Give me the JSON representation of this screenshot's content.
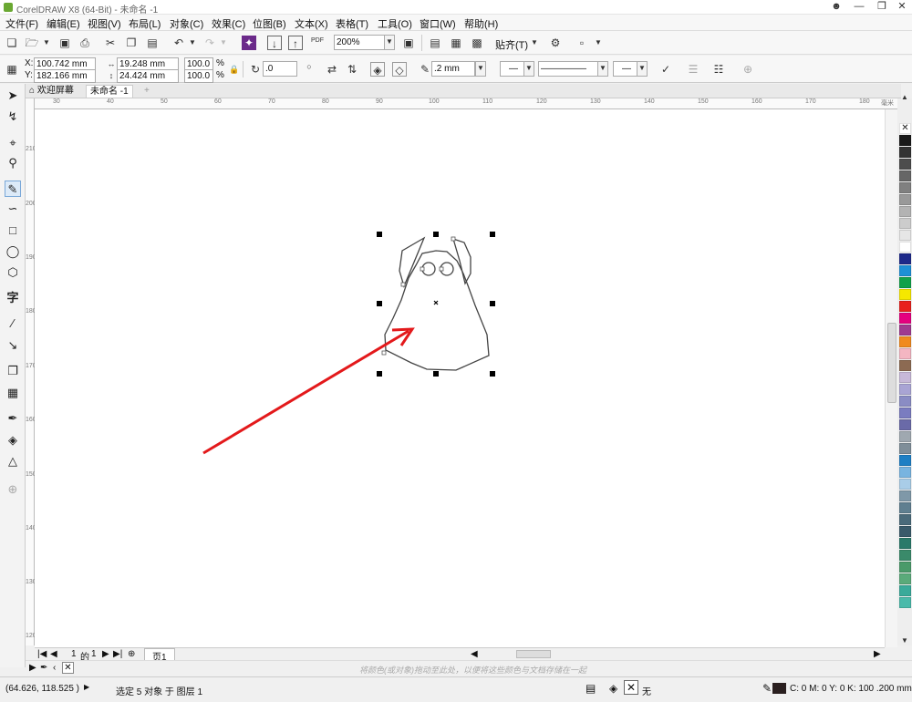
{
  "window": {
    "title": "CorelDRAW X8 (64-Bit) - 未命名 -1"
  },
  "menu": [
    "文件(F)",
    "编辑(E)",
    "视图(V)",
    "布局(L)",
    "对象(C)",
    "效果(C)",
    "位图(B)",
    "文本(X)",
    "表格(T)",
    "工具(O)",
    "窗口(W)",
    "帮助(H)"
  ],
  "toolbar": {
    "zoom_value": "200%",
    "snap_label": "贴齐(T)",
    "pdf_label": "PDF"
  },
  "property_bar": {
    "x_label": "X:",
    "x_value": "100.742 mm",
    "y_label": "Y:",
    "y_value": "182.166 mm",
    "width_value": "19.248 mm",
    "height_value": "24.424 mm",
    "scale_x": "100.0",
    "scale_y": "100.0",
    "percent": "%",
    "rotation_value": ".0",
    "outline_width": ".2 mm"
  },
  "tabs": {
    "welcome": "欢迎屏幕",
    "document": "未命名 -1"
  },
  "rulers": {
    "horizontal": [
      "30",
      "40",
      "50",
      "60",
      "70",
      "80",
      "90",
      "100",
      "110",
      "120",
      "130",
      "140",
      "150",
      "160",
      "170",
      "180"
    ],
    "unit": "毫米",
    "vertical": [
      "210",
      "200",
      "190",
      "180",
      "170",
      "160",
      "150",
      "140",
      "130",
      "120"
    ]
  },
  "page_nav": {
    "current": "1",
    "of_label": "的",
    "total": "1",
    "page_tab": "页1"
  },
  "hint_text": "将颜色(或对象)拖动至此处，以便将这些颜色与文档存储在一起",
  "status": {
    "coords": "(64.626, 118.525 )",
    "selection": "选定 5 对象 于 图层 1",
    "fill_none": "无",
    "outline_color_text": "C: 0 M: 0 Y: 0 K: 100  .200 mm"
  },
  "palette": {
    "colors": [
      "#1a1a1a",
      "#333333",
      "#4d4d4d",
      "#666666",
      "#808080",
      "#999999",
      "#b3b3b3",
      "#cccccc",
      "#e6e6e6",
      "#ffffff",
      "#1e2a8a",
      "#1e90d6",
      "#12a14a",
      "#f5e800",
      "#e8211d",
      "#e4007f",
      "#a03a8f",
      "#f08a1e",
      "#f4b6c2",
      "#8c6a52",
      "#c7b8d8",
      "#a9a4d4",
      "#8a8cc4",
      "#7a7cc0",
      "#6a6aa8",
      "#9fa8b0",
      "#7f8e99",
      "#1e7fc4",
      "#78b4e0",
      "#a9cde8",
      "#7f98a8",
      "#5f7f90",
      "#4a6a7a",
      "#3a5a6a",
      "#2a7a6a",
      "#3a8a6a",
      "#4a9a6a",
      "#5aaa7a",
      "#3aaa9a",
      "#4abaaa"
    ]
  },
  "colors": {
    "accent_red": "#e3191b",
    "handle": "#000000"
  }
}
